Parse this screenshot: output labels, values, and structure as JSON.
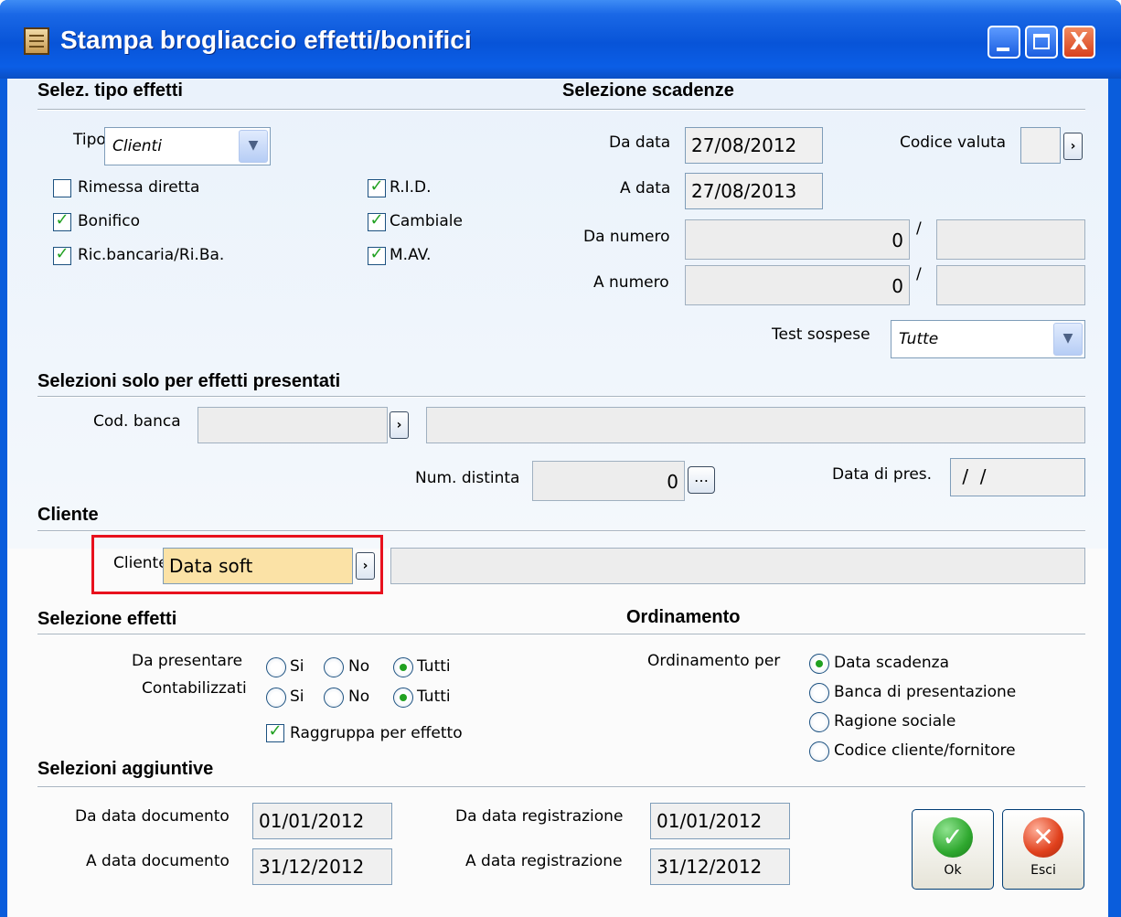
{
  "window": {
    "title": "Stampa brogliaccio effetti/bonifici",
    "min_label": "_",
    "max_label": "□",
    "close_label": "X"
  },
  "sel_tipo": {
    "heading": "Selez. tipo effetti",
    "tipo_label": "Tipo",
    "tipo_value": "Clienti",
    "checks": [
      {
        "label": "Rimessa diretta",
        "checked": false
      },
      {
        "label": "R.I.D.",
        "checked": true
      },
      {
        "label": "Bonifico",
        "checked": true
      },
      {
        "label": "Cambiale",
        "checked": true
      },
      {
        "label": "Ric.bancaria/Ri.Ba.",
        "checked": true
      },
      {
        "label": "M.AV.",
        "checked": true
      }
    ]
  },
  "sel_scadenze": {
    "heading": "Selezione scadenze",
    "da_data_label": "Da data",
    "da_data": "27/08/2012",
    "a_data_label": "A data",
    "a_data": "27/08/2013",
    "codice_valuta_label": "Codice valuta",
    "codice_valuta": "",
    "da_numero_label": "Da numero",
    "da_numero": "0",
    "da_serie": "",
    "a_numero_label": "A numero",
    "a_numero": "0",
    "a_serie": "",
    "slash": "/",
    "test_sospese_label": "Test sospese",
    "test_sospese": "Tutte"
  },
  "presentati": {
    "heading": "Selezioni solo per effetti presentati",
    "cod_banca_label": "Cod. banca",
    "cod_banca": "",
    "banca_desc": "",
    "num_distinta_label": "Num. distinta",
    "num_distinta": "0",
    "data_pres_label": "Data di pres.",
    "data_pres": " /  /"
  },
  "cliente": {
    "heading": "Cliente",
    "label": "Cliente",
    "value": "Data soft",
    "desc": ""
  },
  "sel_effetti": {
    "heading": "Selezione effetti",
    "da_presentare_label": "Da presentare",
    "contabilizzati_label": "Contabilizzati",
    "opt_si": "Si",
    "opt_no": "No",
    "opt_tutti": "Tutti",
    "da_presentare_selected": "Tutti",
    "contabilizzati_selected": "Tutti",
    "raggruppa_label": "Raggruppa per effetto",
    "raggruppa_checked": true
  },
  "ordinamento": {
    "heading": "Ordinamento",
    "label": "Ordinamento per",
    "options": [
      "Data scadenza",
      "Banca di presentazione",
      "Ragione sociale",
      "Codice cliente/fornitore"
    ],
    "selected": "Data scadenza"
  },
  "aggiuntive": {
    "heading": "Selezioni aggiuntive",
    "da_data_doc_label": "Da data documento",
    "da_data_doc": "01/01/2012",
    "a_data_doc_label": "A data documento",
    "a_data_doc": "31/12/2012",
    "da_data_reg_label": "Da data registrazione",
    "da_data_reg": "01/01/2012",
    "a_data_reg_label": "A data registrazione",
    "a_data_reg": "31/12/2012"
  },
  "buttons": {
    "ok_label": "Ok",
    "esci_label": "Esci"
  },
  "colors": {
    "title_bar": "#0854d8",
    "active_field": "#fbe2a6",
    "highlight_box": "#e8111d",
    "check": "#21a121",
    "ok_icon": "#2fa82f",
    "esci_icon": "#e0401c"
  }
}
